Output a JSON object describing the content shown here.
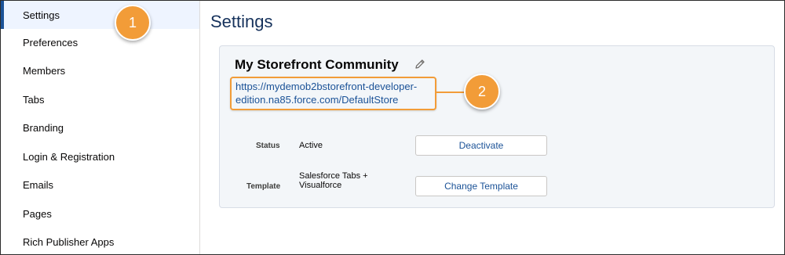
{
  "sidebar": {
    "items": [
      {
        "label": "Settings"
      },
      {
        "label": "Preferences"
      },
      {
        "label": "Members"
      },
      {
        "label": "Tabs"
      },
      {
        "label": "Branding"
      },
      {
        "label": "Login & Registration"
      },
      {
        "label": "Emails"
      },
      {
        "label": "Pages"
      },
      {
        "label": "Rich Publisher Apps"
      }
    ]
  },
  "main": {
    "title": "Settings",
    "card": {
      "community_name": "My Storefront Community",
      "url_line1": "https://mydemob2bstorefront-developer-",
      "url_line2": "edition.na85.force.com/DefaultStore",
      "status_label": "Status",
      "status_value": "Active",
      "deactivate_label": "Deactivate",
      "template_label": "Template",
      "template_value_line1": "Salesforce Tabs +",
      "template_value_line2": "Visualforce",
      "change_template_label": "Change Template"
    }
  },
  "callouts": {
    "badge1": "1",
    "badge2": "2"
  },
  "colors": {
    "accent": "#f29c38",
    "link": "#1b5297",
    "active_nav_bg": "#eef4ff",
    "card_bg": "#f3f6f9"
  },
  "icons": {
    "edit": "pencil-icon"
  }
}
